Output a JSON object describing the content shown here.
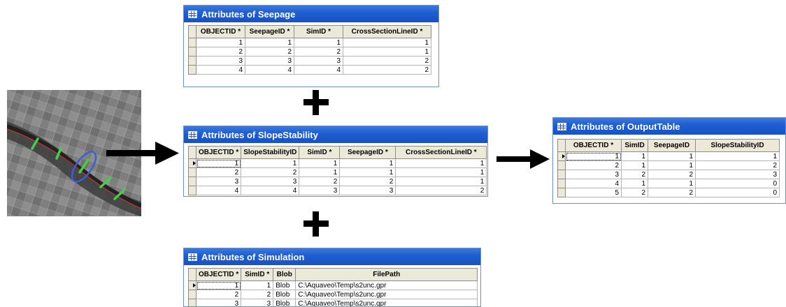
{
  "windows": {
    "seepage": {
      "title": "Attributes of Seepage",
      "columns": [
        "OBJECTID *",
        "SeepageID *",
        "SimID *",
        "CrossSectionLineID *"
      ],
      "rows": [
        [
          "1",
          "1",
          "1",
          "1"
        ],
        [
          "2",
          "2",
          "2",
          "1"
        ],
        [
          "3",
          "3",
          "3",
          "2"
        ],
        [
          "4",
          "4",
          "4",
          "2"
        ]
      ]
    },
    "slope": {
      "title": "Attributes of SlopeStability",
      "columns": [
        "OBJECTID *",
        "SlopeStabilityID",
        "SimID *",
        "SeepageID *",
        "CrossSectionLineID *"
      ],
      "rows": [
        [
          "1",
          "1",
          "1",
          "1",
          "1"
        ],
        [
          "2",
          "2",
          "1",
          "1",
          "1"
        ],
        [
          "3",
          "3",
          "2",
          "2",
          "1"
        ],
        [
          "4",
          "4",
          "3",
          "3",
          "2"
        ]
      ]
    },
    "simulation": {
      "title": "Attributes of Simulation",
      "columns": [
        "OBJECTID *",
        "SimID *",
        "Blob",
        "FilePath"
      ],
      "rows": [
        [
          "1",
          "1",
          "Blob",
          "C:\\Aquaveo\\Temp\\s2unc.gpr"
        ],
        [
          "2",
          "2",
          "Blob",
          "C:\\Aquaveo\\Temp\\s2unc.gpr"
        ],
        [
          "3",
          "3",
          "Blob",
          "C:\\Aquaveo\\Temp\\s2unc.gpr"
        ]
      ]
    },
    "output": {
      "title": "Attributes of OutputTable",
      "columns": [
        "OBJECTID *",
        "SimID",
        "SeepageID",
        "SlopeStabilityID"
      ],
      "rows": [
        [
          "1",
          "1",
          "1",
          "1"
        ],
        [
          "2",
          "1",
          "1",
          "2"
        ],
        [
          "3",
          "2",
          "2",
          "3"
        ],
        [
          "4",
          "1",
          "1",
          "0"
        ],
        [
          "5",
          "2",
          "2",
          "0"
        ]
      ]
    }
  },
  "colors": {
    "titlebar": "#1f5fd0",
    "cross_section_lines": "#44d044",
    "levee_line": "#c0392b",
    "highlight_ellipse": "#3a5fd8"
  }
}
